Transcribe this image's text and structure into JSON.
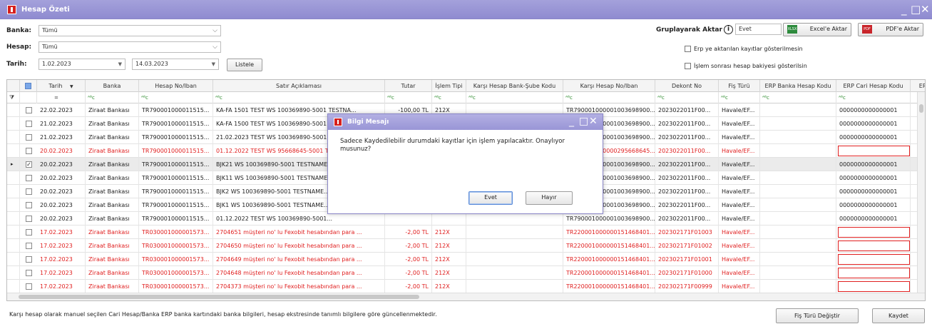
{
  "window": {
    "title": "Hesap Özeti",
    "minimize": "_",
    "maximize": "□",
    "close": "✕"
  },
  "filters": {
    "banka_label": "Banka:",
    "banka_value": "Tümü",
    "hesap_label": "Hesap:",
    "hesap_value": "Tümü",
    "tarih_label": "Tarih:",
    "tarih_start": "1.02.2023",
    "tarih_end": "14.03.2023",
    "listele_label": "Listele"
  },
  "toolbar": {
    "gruplayarak_label": "Gruplayarak Aktar",
    "gruplayarak_value": "Evet",
    "excel_label": "Excel'e Aktar",
    "pdf_label": "PDF'e Aktar",
    "chk_erp_label": "Erp ye aktarılan kayıtlar gösterilmesin",
    "chk_bakiye_label": "İşlem sonrası hesap bakiyesi gösterilsin"
  },
  "columns": [
    "Tarih",
    "Banka",
    "Hesap No/Iban",
    "Satır Açıklaması",
    "Tutar",
    "İşlem Tipi",
    "Karşı Hesap Bank-Şube Kodu",
    "Karşı Hesap No/Iban",
    "Dekont No",
    "Fiş Türü",
    "ERP Banka Hesap Kodu",
    "ERP Cari Hesap Kodu",
    "ERP"
  ],
  "filter_row": {
    "tarih": "=",
    "text": "ᴬᴮc"
  },
  "rows": [
    {
      "tarih": "22.02.2023",
      "banka": "Ziraat Bankası",
      "hesap": "TR790001000011515...",
      "aciklama": "KA-FA 1501 TEST WS 100369890-5001 TESTNA...",
      "tutar": "-100,00 TL",
      "tip": "212X",
      "kbs": "",
      "kiban": "TR790001000001003698900...",
      "dekont": "2023022011F00...",
      "fis": "Havale/EF...",
      "erpb": "",
      "erpc": "0000000000000001",
      "red": false,
      "sel": false,
      "checked": false
    },
    {
      "tarih": "21.02.2023",
      "banka": "Ziraat Bankası",
      "hesap": "TR790001000011515...",
      "aciklama": "KA-FA 1500 TEST WS 100369890-5001 TESTNA...",
      "tutar": "",
      "tip": "",
      "kbs": "",
      "kiban": "TR790001000001003698900...",
      "dekont": "2023022011F00...",
      "fis": "Havale/EF...",
      "erpb": "",
      "erpc": "0000000000000001",
      "red": false,
      "sel": false,
      "checked": false
    },
    {
      "tarih": "21.02.2023",
      "banka": "Ziraat Bankası",
      "hesap": "TR790001000011515...",
      "aciklama": "21.02.2023 TEST WS 100369890-5001 TESTNA...",
      "tutar": "",
      "tip": "",
      "kbs": "",
      "kiban": "TR790001000001003698900...",
      "dekont": "2023022011F00...",
      "fis": "Havale/EF...",
      "erpb": "",
      "erpc": "0000000000000001",
      "red": false,
      "sel": false,
      "checked": false
    },
    {
      "tarih": "20.02.2023",
      "banka": "Ziraat Bankası",
      "hesap": "TR790001000011515...",
      "aciklama": "01.12.2022 TEST WS 95668645-5001 TESTNA...",
      "tutar": "",
      "tip": "",
      "kbs": "",
      "kiban": "TR790001000000295668645...",
      "dekont": "2023022011F00...",
      "fis": "Havale/EF...",
      "erpb": "",
      "erpc": "",
      "red": true,
      "sel": false,
      "checked": false
    },
    {
      "tarih": "20.02.2023",
      "banka": "Ziraat Bankası",
      "hesap": "TR790001000011515...",
      "aciklama": "BJK21 WS 100369890-5001 TESTNAME...",
      "tutar": "",
      "tip": "",
      "kbs": "",
      "kiban": "TR790001000001003698900...",
      "dekont": "2023022011F00...",
      "fis": "Havale/EF...",
      "erpb": "",
      "erpc": "0000000000000001",
      "red": false,
      "sel": true,
      "checked": true
    },
    {
      "tarih": "20.02.2023",
      "banka": "Ziraat Bankası",
      "hesap": "TR790001000011515...",
      "aciklama": "BJK11 WS 100369890-5001 TESTNAME...",
      "tutar": "",
      "tip": "",
      "kbs": "",
      "kiban": "TR790001000001003698900...",
      "dekont": "2023022011F00...",
      "fis": "Havale/EF...",
      "erpb": "",
      "erpc": "0000000000000001",
      "red": false,
      "sel": false,
      "checked": false
    },
    {
      "tarih": "20.02.2023",
      "banka": "Ziraat Bankası",
      "hesap": "TR790001000011515...",
      "aciklama": "BJK2 WS 100369890-5001 TESTNAME...",
      "tutar": "",
      "tip": "",
      "kbs": "",
      "kiban": "TR790001000001003698900...",
      "dekont": "2023022011F00...",
      "fis": "Havale/EF...",
      "erpb": "",
      "erpc": "0000000000000001",
      "red": false,
      "sel": false,
      "checked": false
    },
    {
      "tarih": "20.02.2023",
      "banka": "Ziraat Bankası",
      "hesap": "TR790001000011515...",
      "aciklama": "BJK1 WS 100369890-5001 TESTNAME...",
      "tutar": "",
      "tip": "",
      "kbs": "",
      "kiban": "TR790001000001003698900...",
      "dekont": "2023022011F00...",
      "fis": "Havale/EF...",
      "erpb": "",
      "erpc": "0000000000000001",
      "red": false,
      "sel": false,
      "checked": false
    },
    {
      "tarih": "20.02.2023",
      "banka": "Ziraat Bankası",
      "hesap": "TR790001000011515...",
      "aciklama": "01.12.2022 TEST WS 100369890-5001...",
      "tutar": "",
      "tip": "",
      "kbs": "",
      "kiban": "TR790001000001003698900...",
      "dekont": "2023022011F00...",
      "fis": "Havale/EF...",
      "erpb": "",
      "erpc": "0000000000000001",
      "red": false,
      "sel": false,
      "checked": false
    },
    {
      "tarih": "17.02.2023",
      "banka": "Ziraat Bankası",
      "hesap": "TR030001000001573...",
      "aciklama": "2704651 müşteri no' lu Fexobit hesabından para ...",
      "tutar": "-2,00 TL",
      "tip": "212X",
      "kbs": "",
      "kiban": "TR220001000000151468401...",
      "dekont": "202302171F01003",
      "fis": "Havale/EF...",
      "erpb": "",
      "erpc": "",
      "red": true,
      "sel": false,
      "checked": false
    },
    {
      "tarih": "17.02.2023",
      "banka": "Ziraat Bankası",
      "hesap": "TR030001000001573...",
      "aciklama": "2704650 müşteri no' lu Fexobit hesabından para ...",
      "tutar": "-2,00 TL",
      "tip": "212X",
      "kbs": "",
      "kiban": "TR220001000000151468401...",
      "dekont": "202302171F01002",
      "fis": "Havale/EF...",
      "erpb": "",
      "erpc": "",
      "red": true,
      "sel": false,
      "checked": false
    },
    {
      "tarih": "17.02.2023",
      "banka": "Ziraat Bankası",
      "hesap": "TR030001000001573...",
      "aciklama": "2704649 müşteri no' lu Fexobit hesabından para ...",
      "tutar": "-2,00 TL",
      "tip": "212X",
      "kbs": "",
      "kiban": "TR220001000000151468401...",
      "dekont": "202302171F01001",
      "fis": "Havale/EF...",
      "erpb": "",
      "erpc": "",
      "red": true,
      "sel": false,
      "checked": false
    },
    {
      "tarih": "17.02.2023",
      "banka": "Ziraat Bankası",
      "hesap": "TR030001000001573...",
      "aciklama": "2704648 müşteri no' lu Fexobit hesabından para ...",
      "tutar": "-2,00 TL",
      "tip": "212X",
      "kbs": "",
      "kiban": "TR220001000000151468401...",
      "dekont": "202302171F01000",
      "fis": "Havale/EF...",
      "erpb": "",
      "erpc": "",
      "red": true,
      "sel": false,
      "checked": false
    },
    {
      "tarih": "17.02.2023",
      "banka": "Ziraat Bankası",
      "hesap": "TR030001000001573...",
      "aciklama": "2704373 müşteri no' lu Fexobit hesabından para ...",
      "tutar": "-2,00 TL",
      "tip": "212X",
      "kbs": "",
      "kiban": "TR220001000000151468401...",
      "dekont": "202302171F00999",
      "fis": "Havale/EF...",
      "erpb": "",
      "erpc": "",
      "red": true,
      "sel": false,
      "checked": false
    }
  ],
  "footer": {
    "note": "Karşı hesap olarak manuel seçilen Cari Hesap/Banka ERP banka kartındaki banka bilgileri, hesap ekstresinde tanımlı bilgilere göre güncellenmektedir.",
    "fis_turu_label": "Fiş Türü Değiştir",
    "kaydet_label": "Kaydet"
  },
  "dialog": {
    "title": "Bilgi Mesajı",
    "message": "Sadece Kaydedilebilir durumdaki kayıtlar için işlem yapılacaktır. Onaylıyor musunuz?",
    "yes_label": "Evet",
    "no_label": "Hayır"
  },
  "colors": {
    "title_bar": "#9d9ad8",
    "error_red": "#e01f1f",
    "brand_red": "#d6201e"
  }
}
